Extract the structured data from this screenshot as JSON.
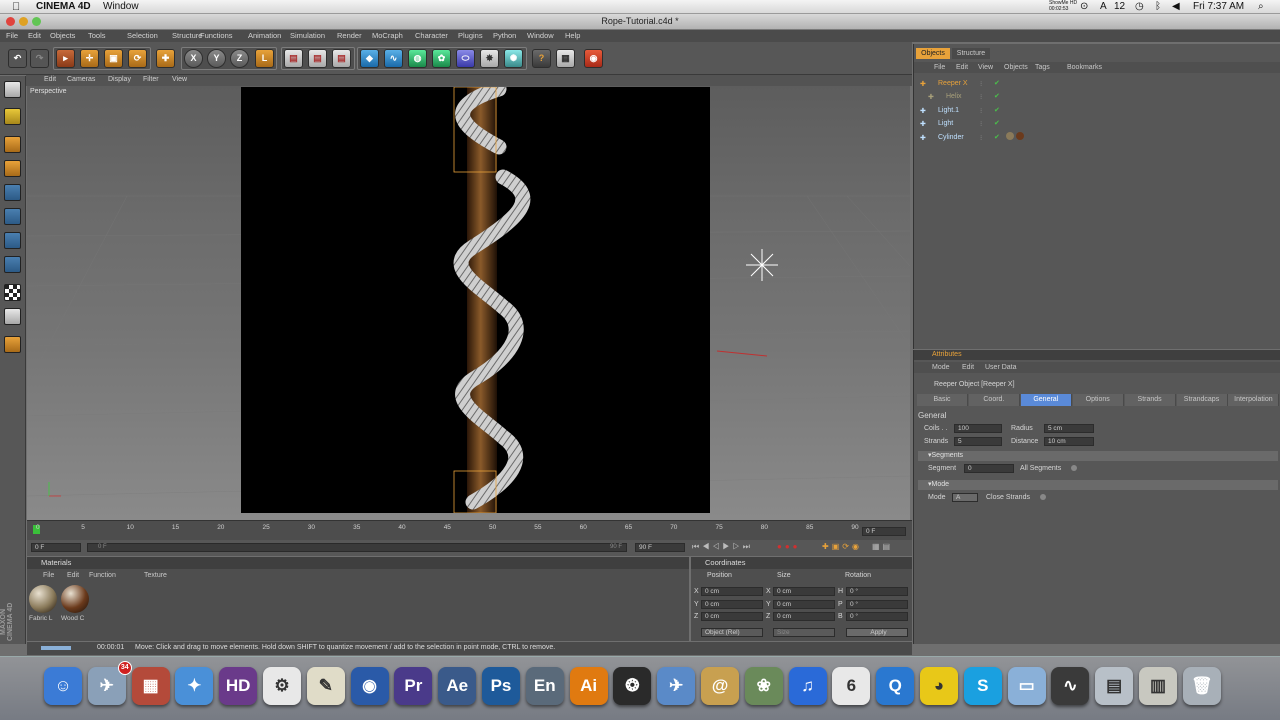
{
  "mac_menubar": {
    "app_name": "CINEMA 4D",
    "window_menu": "Window",
    "recording_badge_line1": "ShowMe HD",
    "recording_badge_line2": "00:02:53",
    "ai_count": "12",
    "clock": "Fri 7:37 AM"
  },
  "window": {
    "title": "Rope-Tutorial.c4d *"
  },
  "app_menu": [
    "File",
    "Edit",
    "Objects",
    "Tools",
    "Selection",
    "Structure",
    "Functions",
    "Animation",
    "Simulation",
    "Render",
    "MoCraph",
    "Character",
    "Plugins",
    "Python",
    "Window",
    "Help"
  ],
  "viewport": {
    "menu": [
      "Edit",
      "Cameras",
      "Display",
      "Filter",
      "View"
    ],
    "label": "Perspective"
  },
  "timeline": {
    "ticks": [
      "0",
      "5",
      "10",
      "15",
      "20",
      "25",
      "30",
      "35",
      "40",
      "45",
      "50",
      "55",
      "60",
      "65",
      "70",
      "75",
      "80",
      "85",
      "90"
    ],
    "current_frame": "0 F",
    "start_field": "0 F",
    "end_field": "90 F",
    "range_start": "0 F",
    "range_end": "90 F"
  },
  "materials": {
    "title": "Materials",
    "menu": [
      "File",
      "Edit",
      "Function",
      "Texture"
    ],
    "items": [
      {
        "name": "Fabric L",
        "color": "#8a7a5a"
      },
      {
        "name": "Wood C",
        "color": "#6b3a1c"
      }
    ]
  },
  "coordinates": {
    "title": "Coordinates",
    "headers": [
      "Position",
      "Size",
      "Rotation"
    ],
    "rows": [
      {
        "axis": "X",
        "pos": "0 cm",
        "size_axis": "X",
        "size": "0 cm",
        "rot_axis": "H",
        "rot": "0 °"
      },
      {
        "axis": "Y",
        "pos": "0 cm",
        "size_axis": "Y",
        "size": "0 cm",
        "rot_axis": "P",
        "rot": "0 °"
      },
      {
        "axis": "Z",
        "pos": "0 cm",
        "size_axis": "Z",
        "size": "0 cm",
        "rot_axis": "B",
        "rot": "0 °"
      }
    ],
    "mode_select": "Object (Rel)",
    "size_select": "Size",
    "apply": "Apply"
  },
  "status": {
    "time": "00:00:01",
    "message": "Move: Click and drag to move elements. Hold down SHIFT to quantize movement / add to the selection in point mode, CTRL to remove."
  },
  "objects_panel": {
    "tabs": [
      "Objects",
      "Structure"
    ],
    "menu": [
      "File",
      "Edit",
      "View",
      "Objects",
      "Tags",
      "Bookmarks"
    ],
    "tree": [
      {
        "name": "Reeper X",
        "color": "#e8a23a",
        "indent": 0
      },
      {
        "name": "Helix",
        "color": "#a8a07a",
        "indent": 1
      },
      {
        "name": "Light.1",
        "color": "#bfe0ff",
        "indent": 0
      },
      {
        "name": "Light",
        "color": "#bfe0ff",
        "indent": 0
      },
      {
        "name": "Cylinder",
        "color": "#bfe0ff",
        "indent": 0
      }
    ]
  },
  "attributes_panel": {
    "title": "Attributes",
    "menu": [
      "Mode",
      "Edit",
      "User Data"
    ],
    "object_label": "Reeper Object [Reeper X]",
    "tabs": [
      "Basic",
      "Coord.",
      "General",
      "Options",
      "Strands",
      "Strandcaps",
      "Interpolation"
    ],
    "active_tab": "General",
    "section": "General",
    "fields": {
      "coils_label": "Coils . .",
      "coils": "100",
      "radius_label": "Radius",
      "radius": "5 cm",
      "strands_label": "Strands",
      "strands": "5",
      "distance_label": "Distance",
      "distance": "10 cm"
    },
    "segments": {
      "title": "Segments",
      "segment_label": "Segment",
      "segment": "0",
      "all_segments": "All Segments"
    },
    "mode": {
      "title": "Mode",
      "mode_label": "Mode",
      "mode_value": "A",
      "close_strands": "Close Strands"
    }
  },
  "brand": "MAXON CINEMA 4D",
  "dock": [
    {
      "name": "Finder",
      "glyph": "☺",
      "color": "#3b7bd6"
    },
    {
      "name": "Mail",
      "glyph": "✈",
      "color": "#8aa0b8",
      "badge": "34"
    },
    {
      "name": "Grapher",
      "glyph": "▦",
      "color": "#b44a3a"
    },
    {
      "name": "Safari",
      "glyph": "✦",
      "color": "#4a90d8"
    },
    {
      "name": "HD",
      "glyph": "HD",
      "color": "#6a3a8a"
    },
    {
      "name": "Utility",
      "glyph": "⚙",
      "color": "#e8e8e8"
    },
    {
      "name": "Script",
      "glyph": "✎",
      "color": "#e0dcc8"
    },
    {
      "name": "Globe",
      "glyph": "◉",
      "color": "#2a5aa8"
    },
    {
      "name": "Premiere",
      "glyph": "Pr",
      "color": "#4a3a8a"
    },
    {
      "name": "After Effects",
      "glyph": "Ae",
      "color": "#3a5a8a"
    },
    {
      "name": "Photoshop",
      "glyph": "Ps",
      "color": "#1e5a9a"
    },
    {
      "name": "Encore",
      "glyph": "En",
      "color": "#5a6a7a"
    },
    {
      "name": "Illustrator",
      "glyph": "Ai",
      "color": "#e07a10"
    },
    {
      "name": "Cinema 4D",
      "glyph": "❂",
      "color": "#2a2a2a"
    },
    {
      "name": "Preview",
      "glyph": "✈",
      "color": "#5a8ac8"
    },
    {
      "name": "Address Book",
      "glyph": "@",
      "color": "#c8a050"
    },
    {
      "name": "iPhoto",
      "glyph": "❀",
      "color": "#6a8a5a"
    },
    {
      "name": "iTunes",
      "glyph": "♫",
      "color": "#2a6ad8"
    },
    {
      "name": "iCal",
      "glyph": "6",
      "color": "#e8e8e8"
    },
    {
      "name": "QuickTime",
      "glyph": "Q",
      "color": "#2a78d0"
    },
    {
      "name": "Cyberduck",
      "glyph": "◕",
      "color": "#e8c818"
    },
    {
      "name": "Skype",
      "glyph": "S",
      "color": "#1aa0e0"
    },
    {
      "name": "Folder",
      "glyph": "▭",
      "color": "#8ab0d8"
    },
    {
      "name": "Activity Monitor",
      "glyph": "∿",
      "color": "#3a3a3a"
    },
    {
      "name": "Downloads",
      "glyph": "▤",
      "color": "#b8c0c8"
    },
    {
      "name": "Documents",
      "glyph": "▥",
      "color": "#c8c8c0"
    },
    {
      "name": "Trash",
      "glyph": "🗑",
      "color": "#a8b0b8"
    }
  ]
}
